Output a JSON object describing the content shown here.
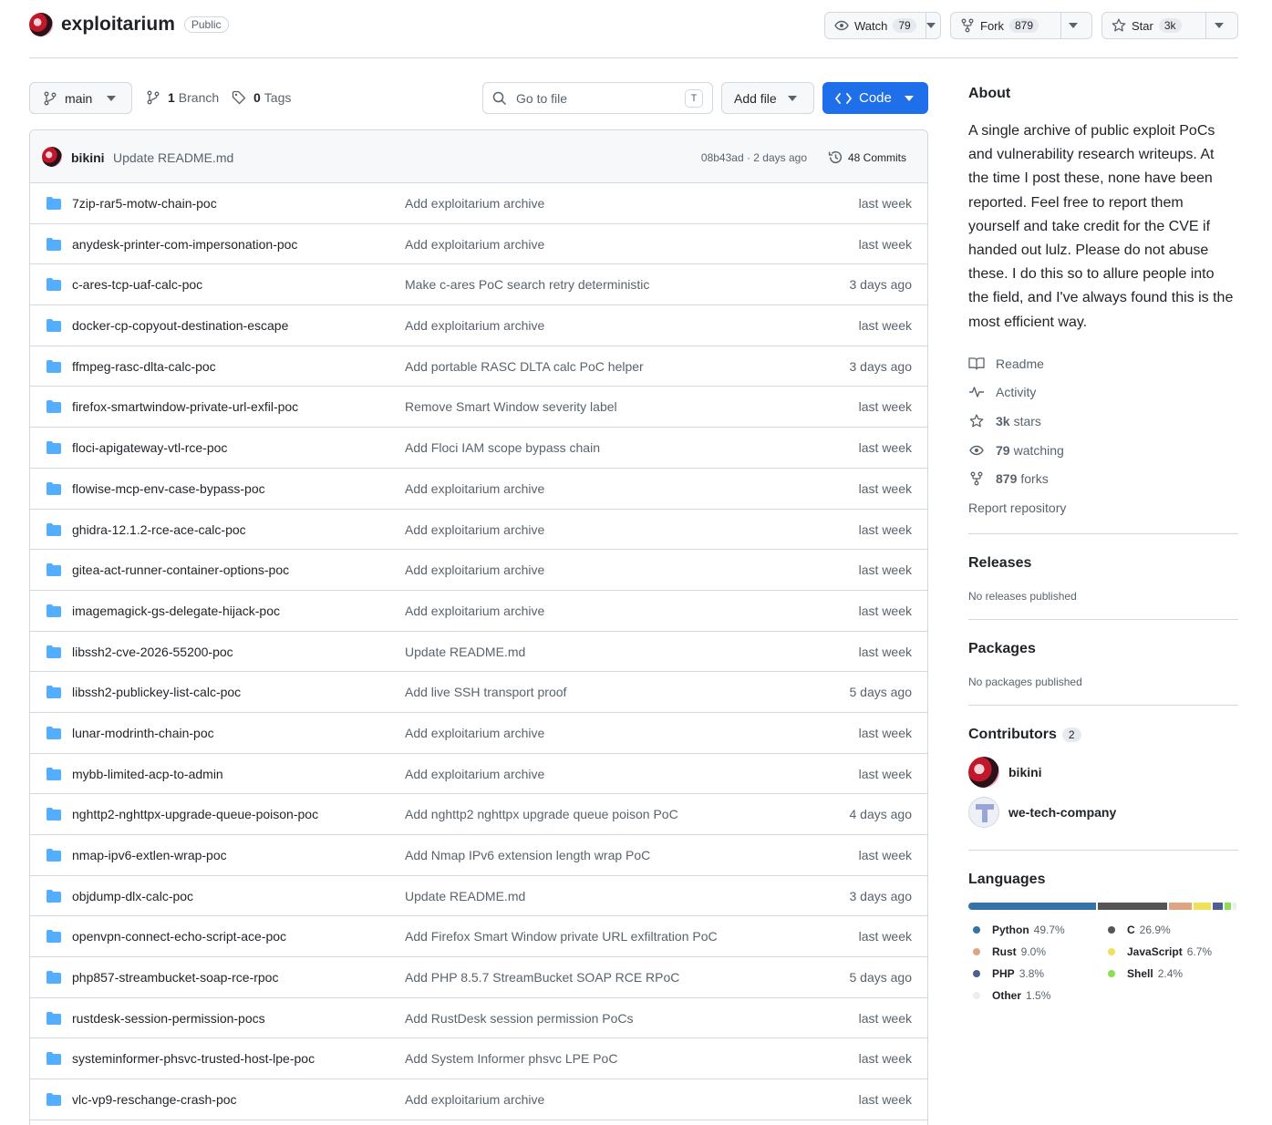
{
  "repo": {
    "name": "exploitarium",
    "visibility": "Public"
  },
  "header_actions": {
    "watch_label": "Watch",
    "watch_count": "79",
    "fork_label": "Fork",
    "fork_count": "879",
    "star_label": "Star",
    "star_count": "3k"
  },
  "controls": {
    "branch": "main",
    "branch_count": "1",
    "branch_label": "Branch",
    "tag_count": "0",
    "tag_label": "Tags",
    "goto_placeholder": "Go to file",
    "goto_shortcut": "T",
    "add_file_label": "Add file",
    "code_label": "Code"
  },
  "latest_commit": {
    "author": "bikini",
    "message": "Update README.md",
    "sha_and_time": "08b43ad · 2 days ago",
    "commit_count": "48 Commits"
  },
  "files": [
    {
      "name": "7zip-rar5-motw-chain-poc",
      "message": "Add exploitarium archive",
      "date": "last week"
    },
    {
      "name": "anydesk-printer-com-impersonation-poc",
      "message": "Add exploitarium archive",
      "date": "last week"
    },
    {
      "name": "c-ares-tcp-uaf-calc-poc",
      "message": "Make c-ares PoC search retry deterministic",
      "date": "3 days ago"
    },
    {
      "name": "docker-cp-copyout-destination-escape",
      "message": "Add exploitarium archive",
      "date": "last week"
    },
    {
      "name": "ffmpeg-rasc-dlta-calc-poc",
      "message": "Add portable RASC DLTA calc PoC helper",
      "date": "3 days ago"
    },
    {
      "name": "firefox-smartwindow-private-url-exfil-poc",
      "message": "Remove Smart Window severity label",
      "date": "last week"
    },
    {
      "name": "floci-apigateway-vtl-rce-poc",
      "message": "Add Floci IAM scope bypass chain",
      "date": "last week"
    },
    {
      "name": "flowise-mcp-env-case-bypass-poc",
      "message": "Add exploitarium archive",
      "date": "last week"
    },
    {
      "name": "ghidra-12.1.2-rce-ace-calc-poc",
      "message": "Add exploitarium archive",
      "date": "last week"
    },
    {
      "name": "gitea-act-runner-container-options-poc",
      "message": "Add exploitarium archive",
      "date": "last week"
    },
    {
      "name": "imagemagick-gs-delegate-hijack-poc",
      "message": "Add exploitarium archive",
      "date": "last week"
    },
    {
      "name": "libssh2-cve-2026-55200-poc",
      "message": "Update README.md",
      "date": "last week"
    },
    {
      "name": "libssh2-publickey-list-calc-poc",
      "message": "Add live SSH transport proof",
      "date": "5 days ago"
    },
    {
      "name": "lunar-modrinth-chain-poc",
      "message": "Add exploitarium archive",
      "date": "last week"
    },
    {
      "name": "mybb-limited-acp-to-admin",
      "message": "Add exploitarium archive",
      "date": "last week"
    },
    {
      "name": "nghttp2-nghttpx-upgrade-queue-poison-poc",
      "message": "Add nghttp2 nghttpx upgrade queue poison PoC",
      "date": "4 days ago"
    },
    {
      "name": "nmap-ipv6-extlen-wrap-poc",
      "message": "Add Nmap IPv6 extension length wrap PoC",
      "date": "last week"
    },
    {
      "name": "objdump-dlx-calc-poc",
      "message": "Update README.md",
      "date": "3 days ago"
    },
    {
      "name": "openvpn-connect-echo-script-ace-poc",
      "message": "Add Firefox Smart Window private URL exfiltration PoC",
      "date": "last week"
    },
    {
      "name": "php857-streambucket-soap-rce-rpoc",
      "message": "Add PHP 8.5.7 StreamBucket SOAP RCE RPoC",
      "date": "5 days ago"
    },
    {
      "name": "rustdesk-session-permission-pocs",
      "message": "Add RustDesk session permission PoCs",
      "date": "last week"
    },
    {
      "name": "systeminformer-phsvc-trusted-host-lpe-poc",
      "message": "Add System Informer phsvc LPE PoC",
      "date": "last week"
    },
    {
      "name": "vlc-vp9-reschange-crash-poc",
      "message": "Add exploitarium archive",
      "date": "last week"
    }
  ],
  "about": {
    "title": "About",
    "description": "A single archive of public exploit PoCs and vulnerability research writeups. At the time I post these, none have been reported. Feel free to report them yourself and take credit for the CVE if handed out lulz. Please do not abuse these. I do this so to allure people into the field, and I've always found this is the most efficient way.",
    "readme": "Readme",
    "activity": "Activity",
    "stars_count": "3k",
    "stars_label": "stars",
    "watching_count": "79",
    "watching_label": "watching",
    "forks_count": "879",
    "forks_label": "forks",
    "report": "Report repository"
  },
  "releases": {
    "title": "Releases",
    "empty": "No releases published"
  },
  "packages": {
    "title": "Packages",
    "empty": "No packages published"
  },
  "contributors": {
    "title": "Contributors",
    "count": "2",
    "list": [
      {
        "name": "bikini"
      },
      {
        "name": "we-tech-company"
      }
    ]
  },
  "languages": {
    "title": "Languages",
    "items": [
      {
        "name": "Python",
        "percent": "49.7%",
        "value": 49.7,
        "color": "#3572A5"
      },
      {
        "name": "C",
        "percent": "26.9%",
        "value": 26.9,
        "color": "#555555"
      },
      {
        "name": "Rust",
        "percent": "9.0%",
        "value": 9.0,
        "color": "#dea584"
      },
      {
        "name": "JavaScript",
        "percent": "6.7%",
        "value": 6.7,
        "color": "#f1e05a"
      },
      {
        "name": "PHP",
        "percent": "3.8%",
        "value": 3.8,
        "color": "#4F5D95"
      },
      {
        "name": "Shell",
        "percent": "2.4%",
        "value": 2.4,
        "color": "#89e051"
      },
      {
        "name": "Other",
        "percent": "1.5%",
        "value": 1.5,
        "color": "#ededed"
      }
    ]
  }
}
